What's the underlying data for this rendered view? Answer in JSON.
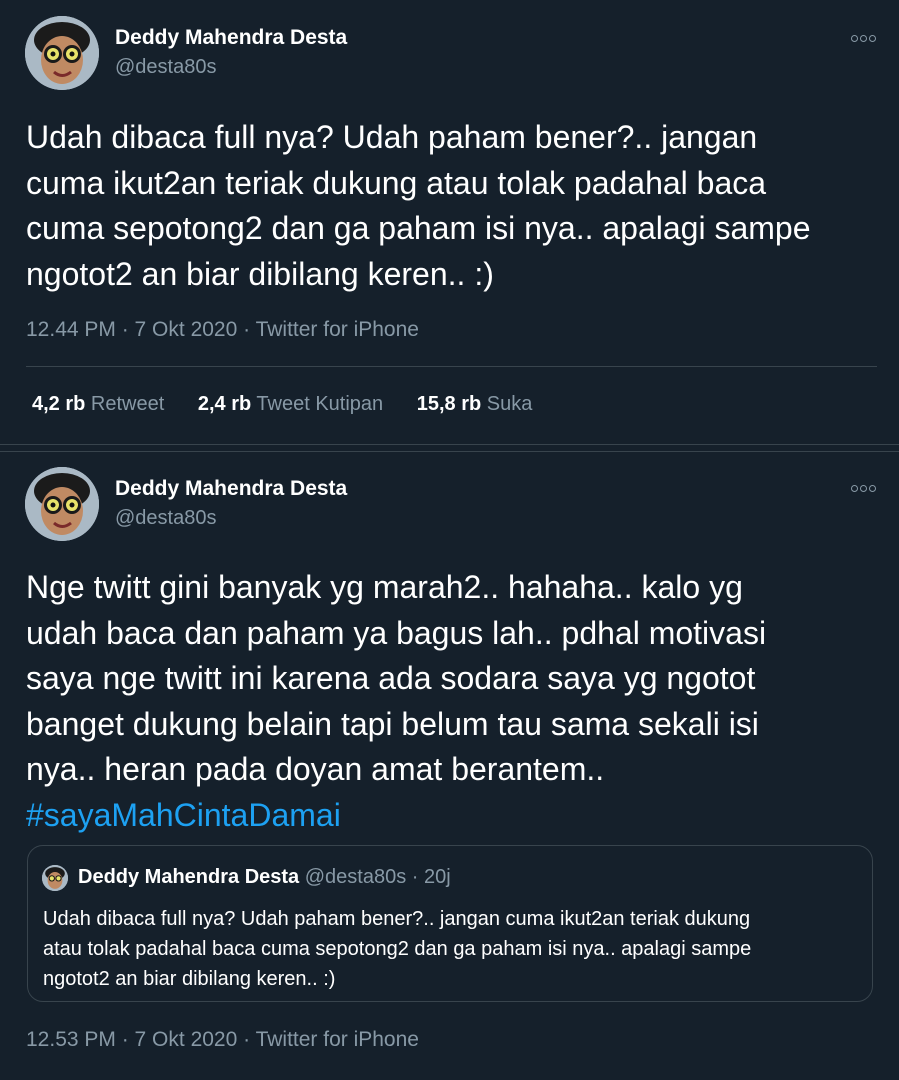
{
  "tweet1": {
    "author_name": "Deddy Mahendra Desta",
    "author_handle": "@desta80s",
    "text_lines": [
      "Udah dibaca full nya? Udah paham bener?.. jangan",
      "cuma ikut2an teriak dukung atau tolak padahal baca",
      "cuma sepotong2 dan ga paham isi nya.. apalagi sampe",
      "ngotot2 an biar dibilang keren.. :)"
    ],
    "timestamp": "12.44 PM · 7 Okt 2020 · Twitter for iPhone",
    "stats": {
      "retweets_count": "4,2 rb",
      "retweets_label": "Retweet",
      "quotes_count": "2,4 rb",
      "quotes_label": "Tweet Kutipan",
      "likes_count": "15,8 rb",
      "likes_label": "Suka"
    }
  },
  "tweet2": {
    "author_name": "Deddy Mahendra Desta",
    "author_handle": "@desta80s",
    "text_lines": [
      "Nge twitt gini banyak yg marah2.. hahaha.. kalo yg",
      "udah baca dan paham ya bagus lah.. pdhal motivasi",
      "saya nge twitt ini karena ada sodara saya yg ngotot",
      "banget dukung belain tapi belum tau sama sekali isi",
      "nya.. heran pada doyan amat berantem.."
    ],
    "hashtag": "#sayaMahCintaDamai",
    "quoted": {
      "author_name": "Deddy Mahendra Desta",
      "author_handle_time": "@desta80s · 20j",
      "text_lines": [
        "Udah dibaca full nya? Udah paham bener?.. jangan cuma ikut2an teriak dukung",
        "atau tolak padahal baca cuma sepotong2 dan ga paham isi nya.. apalagi sampe",
        "ngotot2 an biar dibilang keren.. :)"
      ]
    },
    "timestamp": "12.53 PM · 7 Okt 2020 · Twitter for iPhone"
  },
  "icons": {
    "more": "more-options-icon",
    "avatar": "profile-avatar"
  },
  "colors": {
    "background": "#15202b",
    "border": "#38444d",
    "secondary_text": "#8899a6",
    "link": "#1da1f2"
  }
}
